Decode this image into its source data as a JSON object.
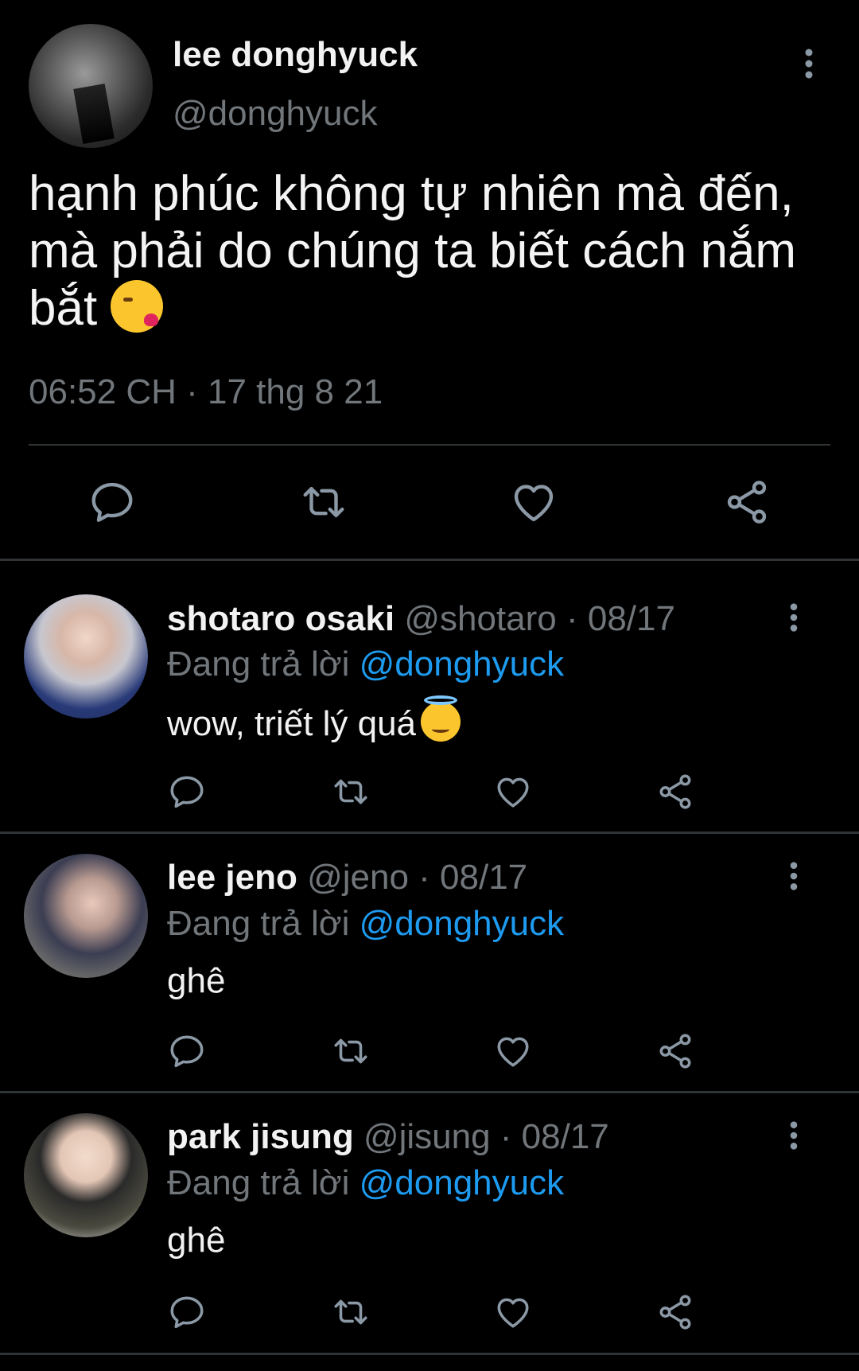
{
  "main_tweet": {
    "display_name": "lee donghyuck",
    "handle": "@donghyuck",
    "text": "hạnh phúc không tự nhiên mà đến, mà phải do chúng ta biết cách nắm bắt",
    "emoji": "kissing-face-with-heart-emoji",
    "timestamp": "06:52 CH · 17 thg 8 21"
  },
  "replies": [
    {
      "display_name": "shotaro osaki",
      "meta": " @shotaro · 08/17",
      "replying_prefix": "Đang trả lời ",
      "replying_to": "@donghyuck",
      "text": "wow, triết lý quá",
      "emoji": "smiling-face-with-halo-emoji"
    },
    {
      "display_name": "lee jeno",
      "meta": " @jeno · 08/17",
      "replying_prefix": "Đang trả lời ",
      "replying_to": "@donghyuck",
      "text": "ghê"
    },
    {
      "display_name": "park jisung",
      "meta": " @jisung · 08/17",
      "replying_prefix": "Đang trả lời ",
      "replying_to": "@donghyuck",
      "text": "ghê"
    }
  ],
  "colors": {
    "background": "#000000",
    "secondary_text": "#71767b",
    "mention": "#1d9bf0",
    "icon": "#8b98a5",
    "divider": "#2f3336"
  },
  "icons": [
    "more-vertical-icon",
    "reply-icon",
    "retweet-icon",
    "like-icon",
    "share-icon"
  ]
}
